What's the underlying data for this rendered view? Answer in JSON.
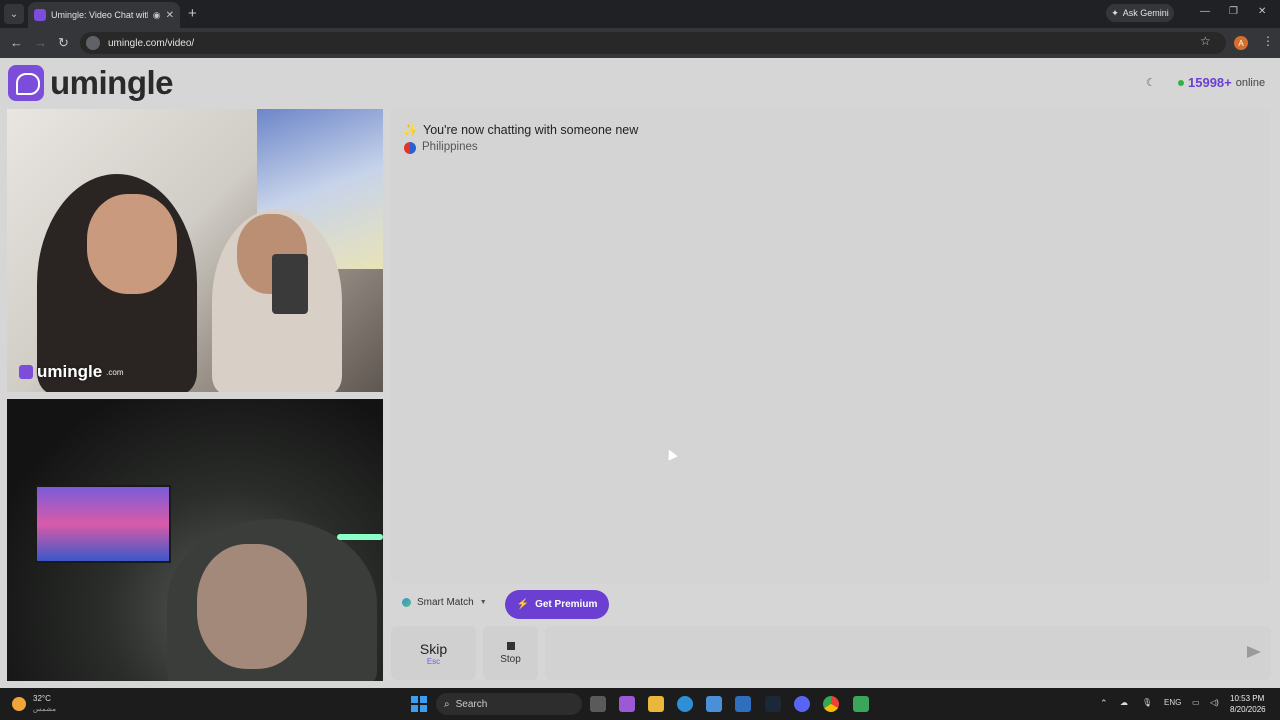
{
  "browser": {
    "tab_title": "Umingle: Video Chat with S",
    "url": "umingle.com/video/",
    "ask_gemini": "Ask Gemini",
    "profile_initial": "A"
  },
  "site": {
    "logo_text": "umingle",
    "online_count": "15998+",
    "online_label": "online"
  },
  "video": {
    "watermark": "umingle",
    "watermark_suffix": ".com"
  },
  "chat": {
    "status_message": "You're now chatting with someone new",
    "country": "Philippines"
  },
  "controls": {
    "smart_match": "Smart Match",
    "get_premium": "Get Premium",
    "skip_label": "Skip",
    "skip_key": "Esc",
    "stop_label": "Stop",
    "message_placeholder": ""
  },
  "taskbar": {
    "temperature": "32°C",
    "weather_desc": "مشمس",
    "search_label": "Search",
    "language": "ENG",
    "time": "10:53 PM",
    "date": "8/20/2026"
  },
  "colors": {
    "brand_purple": "#7c4ddb",
    "online_green": "#2fb344",
    "premium_bg": "#6b3fd1"
  }
}
